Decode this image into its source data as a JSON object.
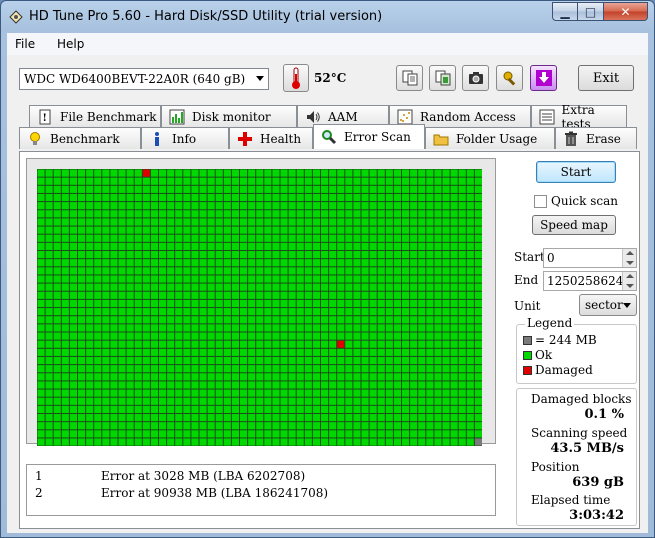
{
  "window": {
    "title": "HD Tune Pro 5.60 - Hard Disk/SSD Utility (trial version)"
  },
  "menu": {
    "file": "File",
    "help": "Help"
  },
  "toolbar": {
    "drive": "WDC WD6400BEVT-22A0R (640 gB)",
    "temperature": "52°C",
    "exit_label": "Exit"
  },
  "tabs": {
    "row1": [
      "File Benchmark",
      "Disk monitor",
      "AAM",
      "Random Access",
      "Extra tests"
    ],
    "row2": [
      "Benchmark",
      "Info",
      "Health",
      "Error Scan",
      "Folder Usage",
      "Erase"
    ],
    "active": "Error Scan"
  },
  "controls": {
    "start_label": "Start",
    "quick_scan_label": "Quick scan",
    "quick_scan_checked": false,
    "speed_map_label": "Speed map",
    "start_field_label": "Start",
    "start_value": "0",
    "end_field_label": "End",
    "end_value": "1250258624",
    "unit_label": "Unit",
    "unit_value": "sector"
  },
  "legend": {
    "title": "Legend",
    "block_size": "= 244 MB",
    "ok": "Ok",
    "damaged": "Damaged"
  },
  "stats": {
    "damaged_label": "Damaged blocks",
    "damaged_value": "0.1 %",
    "speed_label": "Scanning speed",
    "speed_value": "43.5 MB/s",
    "position_label": "Position",
    "position_value": "639 gB",
    "elapsed_label": "Elapsed time",
    "elapsed_value": "3:03:42"
  },
  "log": [
    {
      "num": "1",
      "text": "Error at 3028 MB (LBA 6202708)"
    },
    {
      "num": "2",
      "text": "Error at 90938 MB (LBA 186241708)"
    }
  ],
  "block_map": {
    "columns": 55,
    "rows": 34,
    "total_blocks": 1870,
    "damaged_indices": [
      13,
      1192
    ],
    "colors": {
      "ok": "#00d800",
      "damaged": "#e00000",
      "unscanned": "#7a7a7a",
      "grid": "#1a4d1a"
    }
  }
}
